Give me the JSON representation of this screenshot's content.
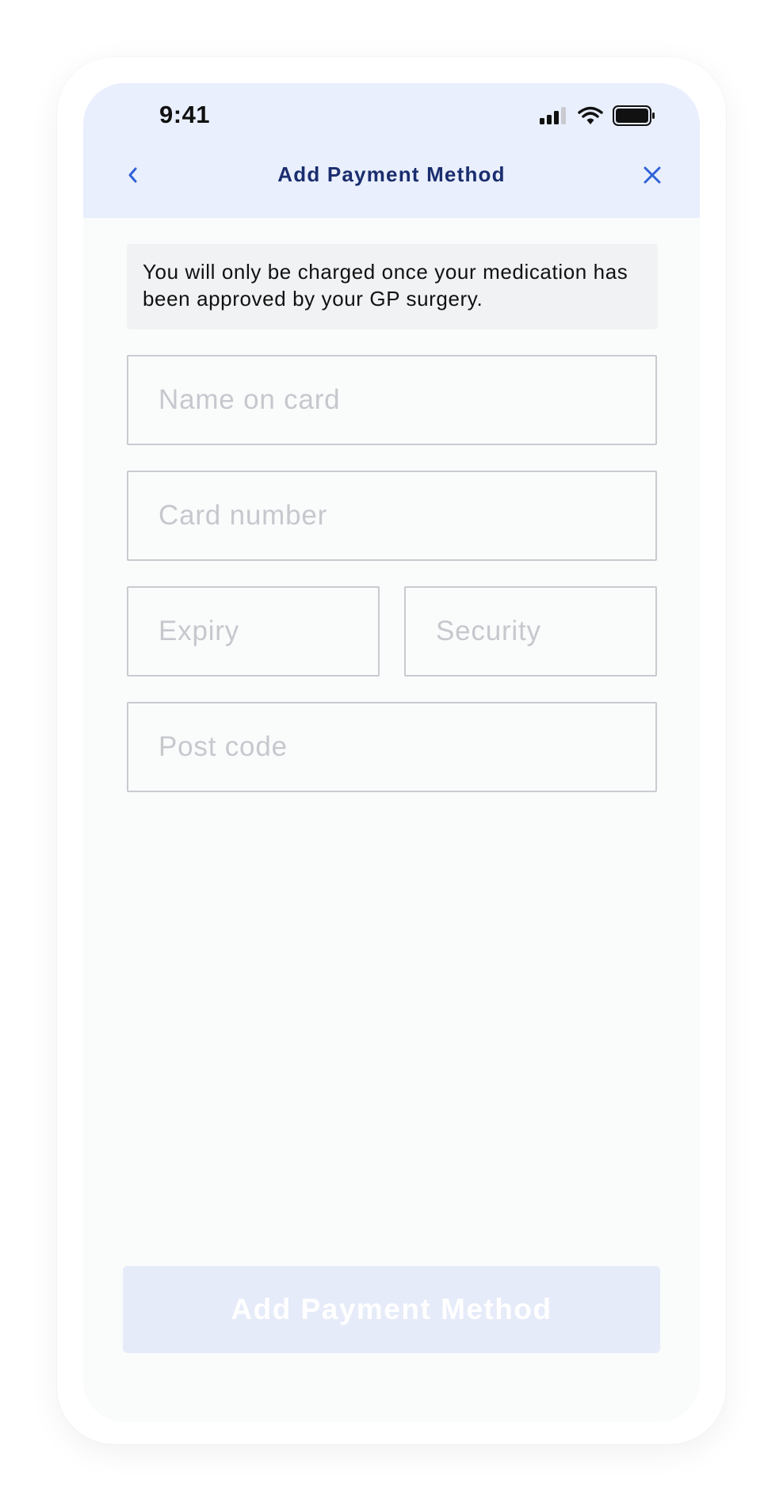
{
  "status_bar": {
    "time": "9:41"
  },
  "nav": {
    "title": "Add Payment Method",
    "back_icon": "chevron-left-icon",
    "close_icon": "close-icon"
  },
  "notice": {
    "text": "You will only be charged once your medication has been approved by your GP surgery."
  },
  "form": {
    "name_placeholder": "Name on card",
    "card_placeholder": "Card number",
    "expiry_placeholder": "Expiry",
    "security_placeholder": "Security",
    "postcode_placeholder": "Post code"
  },
  "submit": {
    "label": "Add Payment Method"
  },
  "colors": {
    "header_bg": "#e9effc",
    "title": "#1a2d6e",
    "accent": "#2f62d8",
    "button_disabled_bg": "#e6ebf9"
  }
}
